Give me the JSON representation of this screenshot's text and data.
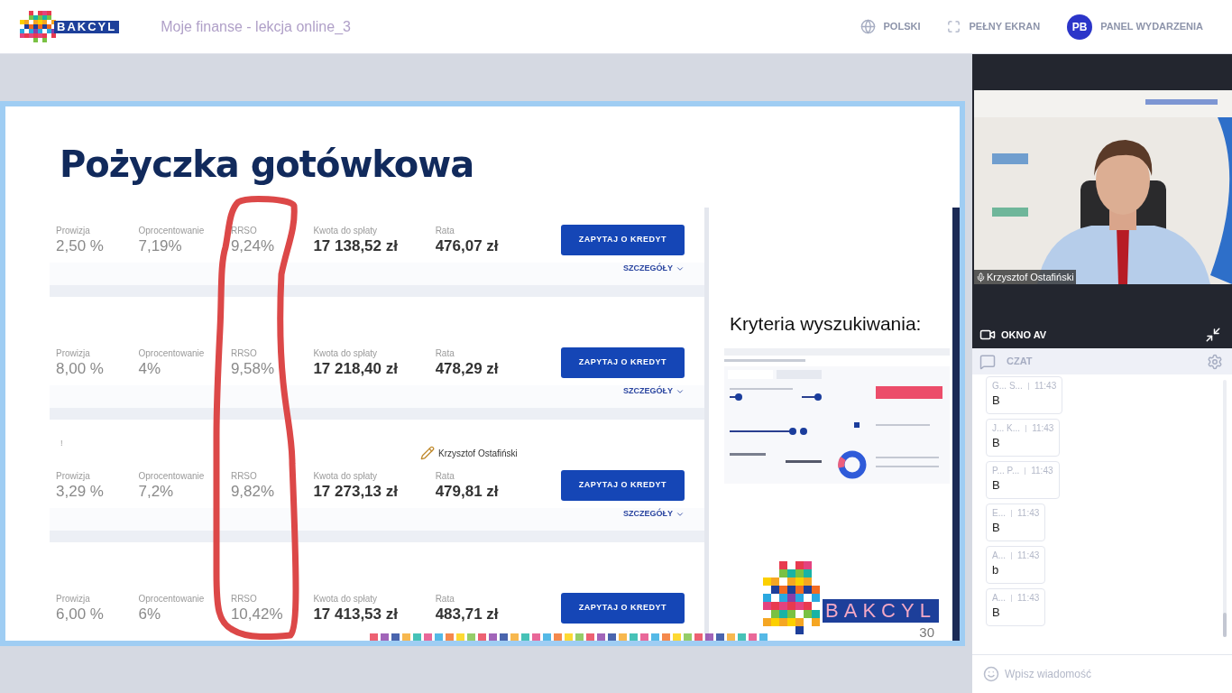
{
  "header": {
    "logo_text": "BAKCYL",
    "title": "Moje finanse - lekcja online_3",
    "actions": [
      {
        "kind": "language",
        "label": "POLSKI"
      },
      {
        "kind": "fullscreen",
        "label": "PEŁNY EKRAN"
      },
      {
        "kind": "panel",
        "label": "PANEL WYDARZENIA",
        "avatar": "PB"
      }
    ]
  },
  "slide": {
    "title": "Pożyczka gotówkowa",
    "offers": [
      {
        "fields": [
          {
            "label": "Prowizja",
            "value": "2,50 %"
          },
          {
            "label": "Oprocentowanie",
            "value": "7,19%"
          },
          {
            "label": "RRSO",
            "value": "9,24%"
          },
          {
            "label": "Kwota do spłaty",
            "value": "17 138,52 zł"
          },
          {
            "label": "Rata",
            "value": "476,07 zł"
          }
        ],
        "button": "ZAPYTAJ O KREDYT",
        "details": "SZCZEGÓŁY"
      },
      {
        "fields": [
          {
            "label": "Prowizja",
            "value": "8,00 %"
          },
          {
            "label": "Oprocentowanie",
            "value": "4%"
          },
          {
            "label": "RRSO",
            "value": "9,58%"
          },
          {
            "label": "Kwota do spłaty",
            "value": "17 218,40 zł"
          },
          {
            "label": "Rata",
            "value": "478,29 zł"
          }
        ],
        "button": "ZAPYTAJ O KREDYT",
        "details": "SZCZEGÓŁY"
      },
      {
        "mark": "!",
        "fields": [
          {
            "label": "Prowizja",
            "value": "3,29 %"
          },
          {
            "label": "Oprocentowanie",
            "value": "7,2%"
          },
          {
            "label": "RRSO",
            "value": "9,82%"
          },
          {
            "label": "Kwota do spłaty",
            "value": "17 273,13 zł"
          },
          {
            "label": "Rata",
            "value": "479,81 zł"
          }
        ],
        "button": "ZAPYTAJ O KREDYT",
        "details": "SZCZEGÓŁY"
      },
      {
        "fields": [
          {
            "label": "Prowizja",
            "value": "6,00 %"
          },
          {
            "label": "Oprocentowanie",
            "value": "6%"
          },
          {
            "label": "RRSO",
            "value": "10,42%"
          },
          {
            "label": "Kwota do spłaty",
            "value": "17 413,53 zł"
          },
          {
            "label": "Rata",
            "value": "483,71 zł"
          }
        ],
        "button": "ZAPYTAJ O KREDYT"
      }
    ],
    "criteria_title": "Kryteria wyszukiwania:",
    "logo_text": "BAKCYL",
    "page_number": "30",
    "pointer_label": "Krzysztof Ostafiński"
  },
  "video": {
    "kind": "picture",
    "speaker": "Krzysztof Ostafiński",
    "panel_title": "OKNO AV"
  },
  "chat": {
    "title": "CZAT",
    "messages": [
      {
        "author": "G... S...",
        "time": "11:43",
        "text": "B"
      },
      {
        "author": "J... K...",
        "time": "11:43",
        "text": "B"
      },
      {
        "author": "P... P...",
        "time": "11:43",
        "text": "B"
      },
      {
        "author": "E...",
        "time": "11:43",
        "text": "B"
      },
      {
        "author": "A...",
        "time": "11:43",
        "text": "b"
      },
      {
        "author": "A...",
        "time": "11:43",
        "text": "B"
      }
    ],
    "input": {
      "placeholder": "Wpisz wiadomość"
    }
  }
}
